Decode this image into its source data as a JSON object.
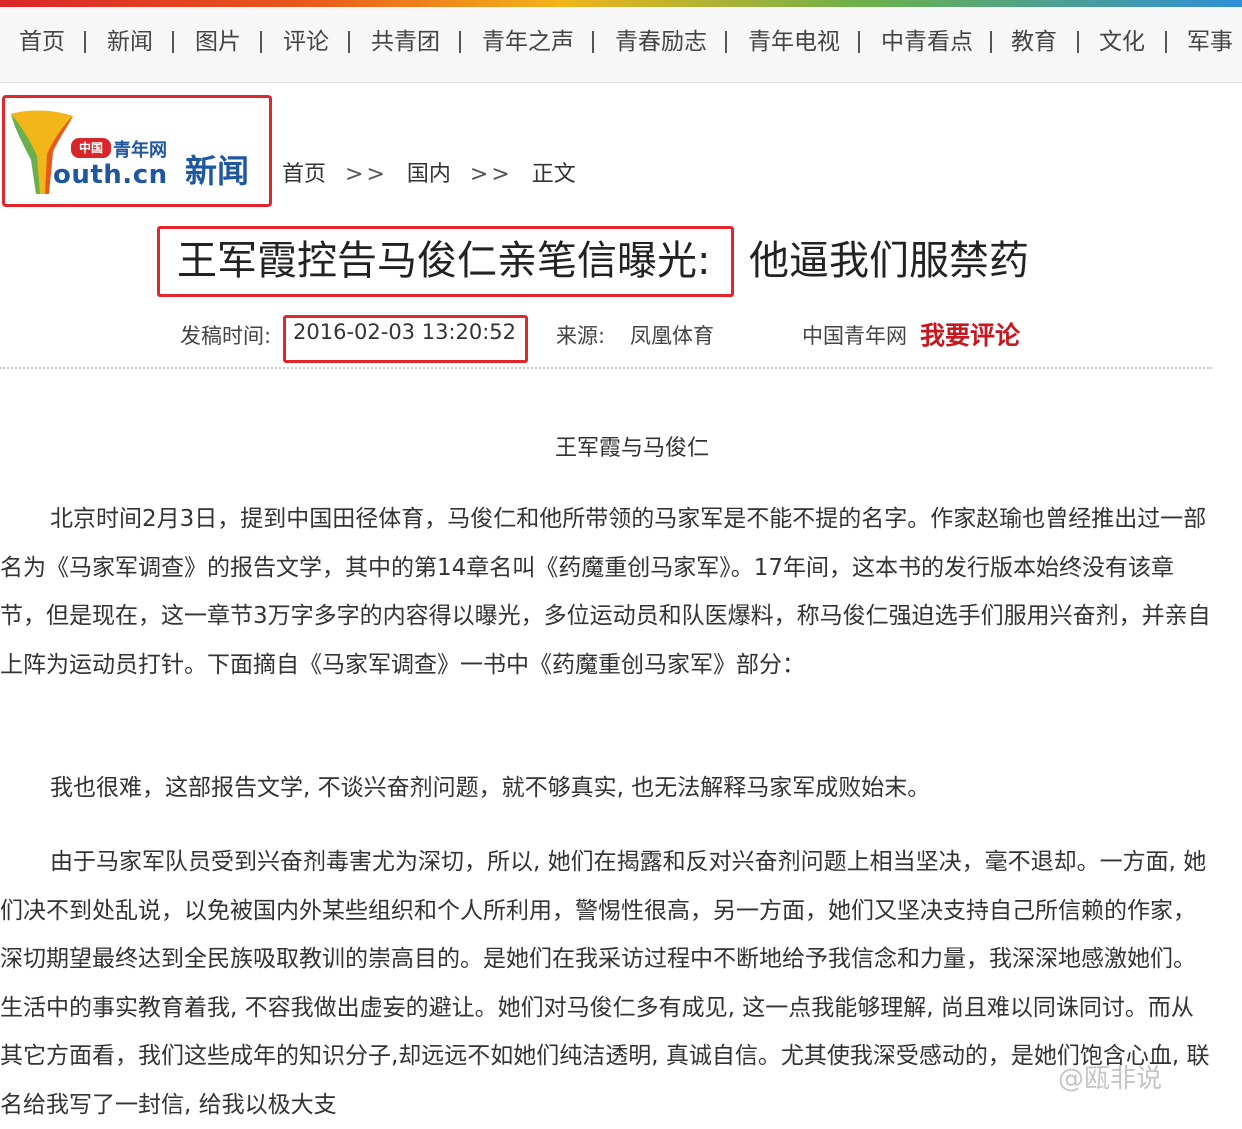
{
  "nav": {
    "items": [
      "首页",
      "新闻",
      "图片",
      "评论",
      "共青团",
      "青年之声",
      "青春励志",
      "青年电视",
      "中青看点",
      "教育",
      "文化",
      "军事"
    ]
  },
  "logo": {
    "badge": "中国",
    "cn_name": "青年网",
    "domain": "outh.cn",
    "section": "新闻"
  },
  "breadcrumb": {
    "home": "首页",
    "sep": ">>",
    "category": "国内",
    "current": "正文"
  },
  "article": {
    "title_part1": "王军霞控告马俊仁亲笔信曝光:",
    "title_part2": "他逼我们服禁药",
    "date_label": "发稿时间:",
    "date": "2016-02-03 13:20:52",
    "source_label": "来源:",
    "source": "凤凰体育",
    "site_name": "中国青年网",
    "comment_label": "我要评论",
    "image_caption": "王军霞与马俊仁",
    "paragraphs": [
      "北京时间2月3日，提到中国田径体育，马俊仁和他所带领的马家军是不能不提的名字。作家赵瑜也曾经推出过一部名为《马家军调查》的报告文学，其中的第14章名叫《药魔重创马家军》。17年间，这本书的发行版本始终没有该章节，但是现在，这一章节3万字多字的内容得以曝光，多位运动员和队医爆料，称马俊仁强迫选手们服用兴奋剂，并亲自上阵为运动员打针。下面摘自《马家军调查》一书中《药魔重创马家军》部分：",
      "我也很难，这部报告文学, 不谈兴奋剂问题，就不够真实, 也无法解释马家军成败始末。",
      "由于马家军队员受到兴奋剂毒害尤为深切，所以, 她们在揭露和反对兴奋剂问题上相当坚决，毫不退却。一方面, 她们决不到处乱说，以免被国内外某些组织和个人所利用，警惕性很高，另一方面，她们又坚决支持自己所信赖的作家，深切期望最终达到全民族吸取教训的崇高目的。是她们在我采访过程中不断地给予我信念和力量，我深深地感激她们。生活中的事实教育着我, 不容我做出虚妄的避让。她们对马俊仁多有成见, 这一点我能够理解, 尚且难以同诛同讨。而从其它方面看，我们这些成年的知识分子,却远远不如她们纯洁透明, 真诚自信。尤其使我深受感动的，是她们饱含心血, 联名给我写了一封信, 给我以极大支"
    ]
  },
  "watermark": "@瓯非说",
  "colors": {
    "highlight_box": "#e3262b",
    "comment_red": "#c8161e",
    "logo_blue": "#1f56a0"
  }
}
